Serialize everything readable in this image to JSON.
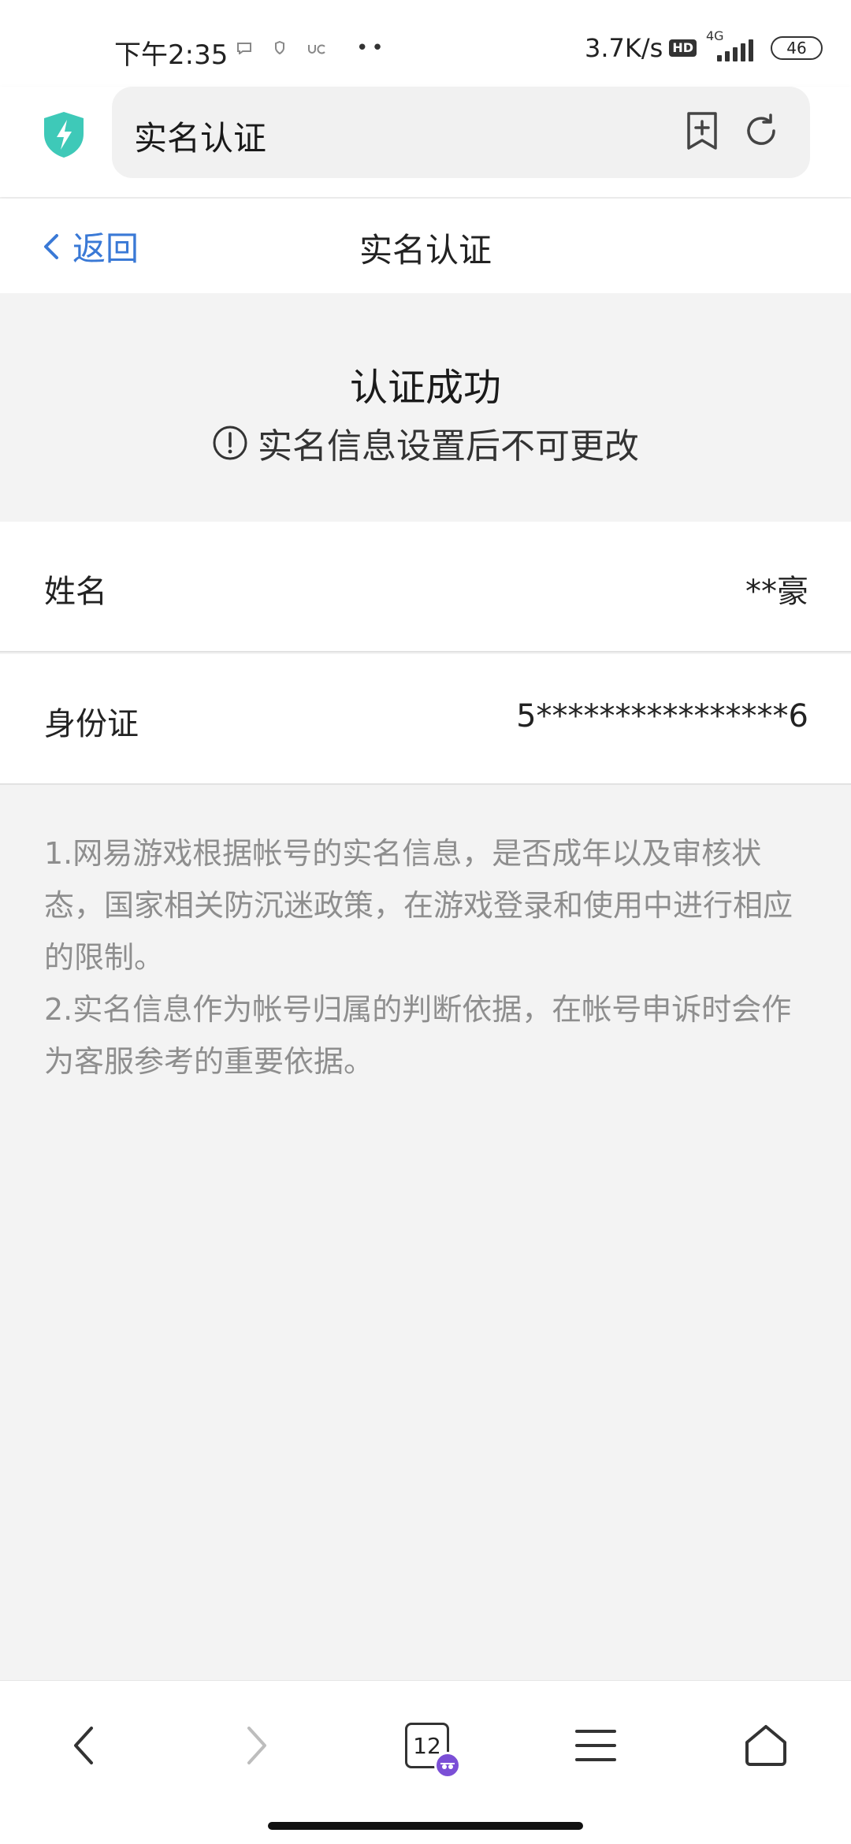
{
  "status_bar": {
    "time": "下午2:35",
    "dots": "••",
    "net_speed": "3.7K/s",
    "hd_label": "HD",
    "network_type": "4G",
    "battery": "46"
  },
  "browser": {
    "address": "实名认证"
  },
  "header": {
    "back_label": "返回",
    "title": "实名认证"
  },
  "result": {
    "title": "认证成功",
    "notice": "实名信息设置后不可更改"
  },
  "fields": {
    "name": {
      "label": "姓名",
      "value": "**豪"
    },
    "id_card": {
      "label": "身份证",
      "value": "5****************6"
    }
  },
  "notes": {
    "line1": "1.网易游戏根据帐号的实名信息，是否成年以及审核状态，国家相关防沉迷政策，在游戏登录和使用中进行相应的限制。",
    "line2": "2.实名信息作为帐号归属的判断依据，在帐号申诉时会作为客服参考的重要依据。"
  },
  "bottom_nav": {
    "tab_count": "12"
  },
  "colors": {
    "accent_blue": "#3a79d6",
    "shield_teal": "#3ec9b8",
    "incognito_purple": "#7b4fd6"
  }
}
